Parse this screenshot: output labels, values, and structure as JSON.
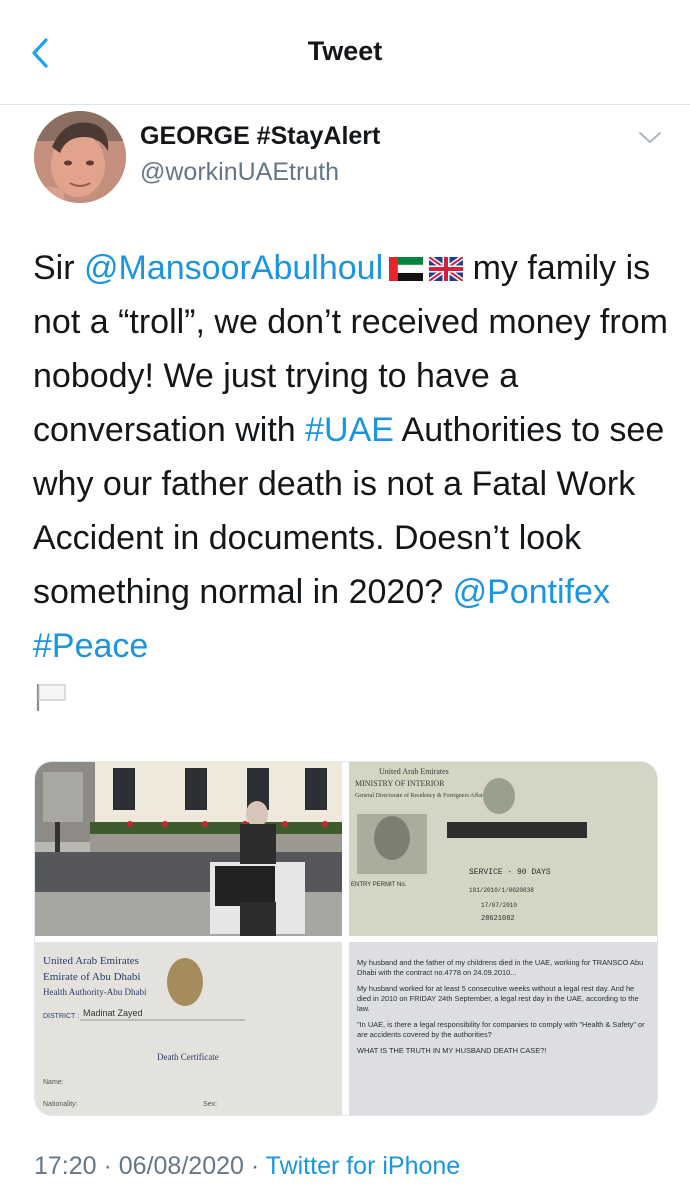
{
  "header": {
    "title": "Tweet"
  },
  "author": {
    "name": "GEORGE #StayAlert",
    "handle": "@workinUAEtruth"
  },
  "tweet": {
    "t1": "Sir ",
    "mention1": "@MansoorAbulhoul",
    "t2": " my family is not a “troll”, we don’t received money from nobody! We just trying to have a conversation with ",
    "hashtag1": "#UAE",
    "t3": " Authorities to see why our father death is not a Fatal Work Accident in documents. Doesn’t look something normal in 2020? ",
    "mention2": "@Pontifex",
    "t4": " ",
    "hashtag2": "#Peace",
    "emoji": [
      "uae-flag",
      "uk-flag",
      "white-flag"
    ]
  },
  "media": {
    "doc1": {
      "country": "United Arab Emirates",
      "ministry": "MINISTRY OF INTERIOR",
      "dept": "General Directorate of Residency & Foreigners Affairs",
      "service": "SERVICE - 90 DAYS",
      "permit": "ENTRY PERMIT No.",
      "number1": "101/2010/1/0020838",
      "date": "17/07/2010",
      "number2": "28621082"
    },
    "doc2": {
      "line1": "United Arab Emirates",
      "line2": "Emirate of Abu Dhabi",
      "line3": "Health Authority-Abu Dhabi",
      "district_label": "DISTRICT :",
      "district": "Madinat Zayed",
      "cert": "Death Certificate",
      "name_label": "Name:",
      "nationality_label": "Nationality:",
      "sex_label": "Sex:"
    },
    "letter": {
      "p1": "My husband and the father of my childrens died in the UAE, working for TRANSCO Abu Dhabi with the contract no.4778 on 24.09.2010...",
      "p2": "My husband worked for at least 5 consecutive weeks without a legal rest day. And he died in 2010 on FRIDAY 24th September, a legal rest day in the UAE, according to the law.",
      "p3": "\"In UAE, is there a legal responsibility for companies to comply with \"Health & Safety\" or are accidents covered by the authorities?",
      "p4": "WHAT IS THE TRUTH IN MY HUSBAND DEATH CASE?!"
    }
  },
  "meta": {
    "time": "17:20 · 06/08/2020 · ",
    "source": "Twitter for iPhone"
  },
  "colors": {
    "link": "#1b95e0",
    "secondary": "#657786",
    "text": "#14171a"
  }
}
